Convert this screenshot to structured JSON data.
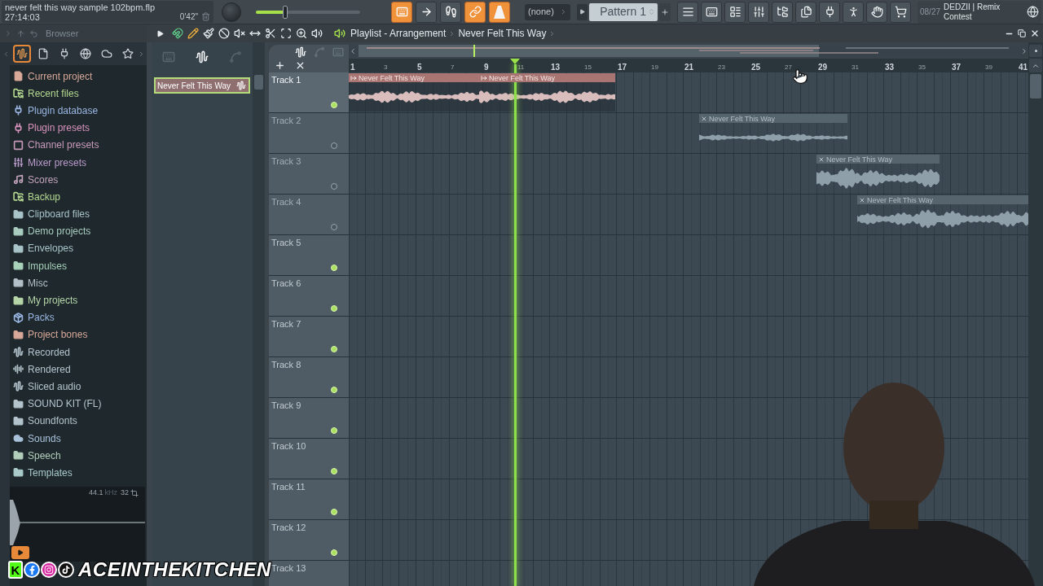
{
  "project": {
    "file": "never felt this way sample 102bpm.flp",
    "time": "27:14:03",
    "cpu": "0'42\""
  },
  "toolbar": {
    "position_slider": {
      "level": 0.28
    },
    "buttons": [
      {
        "on": true
      },
      {
        "on": false
      },
      {
        "on": false
      },
      {
        "on": true
      },
      {
        "on": true
      }
    ],
    "pattern_picker": "(none)",
    "pattern": "Pattern 1"
  },
  "hint": {
    "date": "08/27",
    "text": "DEDZII | Remix Contest"
  },
  "browser": {
    "title": "Browser",
    "tabs": [
      {
        "selected": true
      },
      {
        "selected": false
      },
      {
        "selected": false
      },
      {
        "selected": false
      },
      {
        "selected": false
      },
      {
        "selected": false
      }
    ],
    "items": [
      {
        "label": "Current project",
        "color": "#d8a898"
      },
      {
        "label": "Recent files",
        "color": "#b4d890"
      },
      {
        "label": "Plugin database",
        "color": "#9ab6e2"
      },
      {
        "label": "Plugin presets",
        "color": "#d892bc"
      },
      {
        "label": "Channel presets",
        "color": "#c89abc"
      },
      {
        "label": "Mixer presets",
        "color": "#bc9ccc"
      },
      {
        "label": "Scores",
        "color": "#c4a4bc"
      },
      {
        "label": "Backup",
        "color": "#b4d890"
      },
      {
        "label": "Clipboard files",
        "color": "#a8c4c8"
      },
      {
        "label": "Demo projects",
        "color": "#a8ccbe"
      },
      {
        "label": "Envelopes",
        "color": "#a8c4c8"
      },
      {
        "label": "Impulses",
        "color": "#a8d2ba"
      },
      {
        "label": "Misc",
        "color": "#b4c0c8"
      },
      {
        "label": "My projects",
        "color": "#b6d6a8"
      },
      {
        "label": "Packs",
        "color": "#9ab6e2"
      },
      {
        "label": "Project bones",
        "color": "#d8a898"
      },
      {
        "label": "Recorded",
        "color": "#b4c4cc"
      },
      {
        "label": "Rendered",
        "color": "#b4c4cc"
      },
      {
        "label": "Sliced audio",
        "color": "#b4c4cc"
      },
      {
        "label": "SOUND KIT (FL)",
        "color": "#b4c4cc"
      },
      {
        "label": "Soundfonts",
        "color": "#b4c4cc"
      },
      {
        "label": "Sounds",
        "color": "#a8c2da"
      },
      {
        "label": "Speech",
        "color": "#b2ceba"
      },
      {
        "label": "Templates",
        "color": "#a8cac8"
      }
    ],
    "preview": {
      "sample_rate": "44.1",
      "unit": "kHz",
      "bit_depth": "32"
    }
  },
  "picker": {
    "tabs": [
      {
        "selected": false
      },
      {
        "selected": true
      },
      {
        "selected": false
      }
    ],
    "items": [
      {
        "label": "Never Felt This Way",
        "selected": true
      }
    ]
  },
  "playlist": {
    "title": "Playlist - Arrangement",
    "arrangement": "Never Felt This Way",
    "filters": [
      {
        "selected": true
      },
      {
        "selected": false
      },
      {
        "selected": false
      }
    ],
    "ruler": [
      "1",
      "3",
      "5",
      "7",
      "9",
      "11",
      "13",
      "15",
      "17",
      "19",
      "21",
      "23",
      "25",
      "27",
      "29",
      "31",
      "33",
      "35",
      "37",
      "39",
      "41"
    ],
    "playhead": {
      "level": 0.245
    },
    "tracks": [
      {
        "name": "Track 1",
        "selected": true,
        "muted": false,
        "clips": [
          {
            "name": "Never Felt This Way",
            "muted": false
          },
          {
            "name": "Never Felt This Way",
            "muted": false
          }
        ]
      },
      {
        "name": "Track 2",
        "selected": false,
        "muted": true,
        "clips": [
          {
            "name": "Never Felt This Way",
            "muted": true
          }
        ]
      },
      {
        "name": "Track 3",
        "selected": false,
        "muted": true,
        "clips": [
          {
            "name": "Never Felt This Way",
            "muted": true
          }
        ]
      },
      {
        "name": "Track 4",
        "selected": false,
        "muted": true,
        "clips": [
          {
            "name": "Never Felt This Way",
            "muted": true
          }
        ]
      },
      {
        "name": "Track 5",
        "selected": false,
        "muted": false
      },
      {
        "name": "Track 6",
        "selected": false,
        "muted": false
      },
      {
        "name": "Track 7",
        "selected": false,
        "muted": false
      },
      {
        "name": "Track 8",
        "selected": false,
        "muted": false
      },
      {
        "name": "Track 9",
        "selected": false,
        "muted": false
      },
      {
        "name": "Track 10",
        "selected": false,
        "muted": false
      },
      {
        "name": "Track 11",
        "selected": false,
        "muted": false
      },
      {
        "name": "Track 12",
        "selected": false,
        "muted": false
      },
      {
        "name": "Track 13",
        "selected": false
      }
    ]
  },
  "overlay": {
    "kick_mark": "K",
    "handle": "ACEINTHEKITCHEN"
  }
}
